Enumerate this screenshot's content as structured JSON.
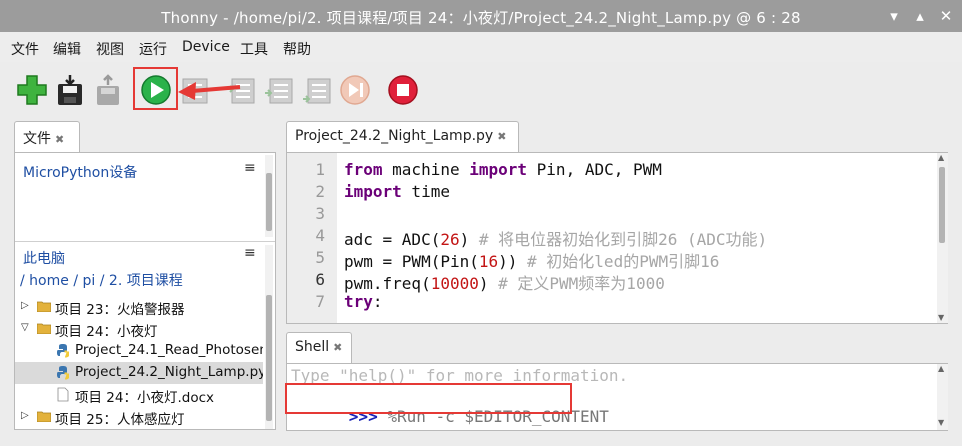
{
  "window": {
    "title": "Thonny  -  /home/pi/2. 项目课程/项目 24：小夜灯/Project_24.2_Night_Lamp.py  @  6 : 28",
    "controls": [
      "▾",
      "▴",
      "✕"
    ]
  },
  "menubar": {
    "items": [
      "文件",
      "编辑",
      "视图",
      "运行",
      "Device",
      "工具",
      "帮助"
    ]
  },
  "toolbar": {
    "buttons": [
      "new",
      "save",
      "load",
      "run",
      "debug",
      "step-over",
      "step-into",
      "step-out",
      "resume",
      "stop"
    ]
  },
  "files_panel": {
    "tab_label": "文件",
    "device_section": "MicroPython设备",
    "computer_section": "此电脑",
    "breadcrumb": {
      "root": "/",
      "home": "home",
      "sep1": "/",
      "pi": "pi",
      "sep2": "/",
      "folder": "2. 项目课程"
    },
    "tree": [
      {
        "arrow": "▷",
        "type": "folder",
        "label": "项目 23：火焰警报器"
      },
      {
        "arrow": "▽",
        "type": "folder",
        "label": "项目 24：小夜灯"
      },
      {
        "arrow": "",
        "type": "python",
        "label": "Project_24.1_Read_Photosensitive.py"
      },
      {
        "arrow": "",
        "type": "python",
        "label": "Project_24.2_Night_Lamp.py",
        "selected": true
      },
      {
        "arrow": "",
        "type": "doc",
        "label": "项目 24：小夜灯.docx"
      },
      {
        "arrow": "▷",
        "type": "folder",
        "label": "项目 25：人体感应灯"
      }
    ]
  },
  "editor": {
    "tab_label": "Project_24.2_Night_Lamp.py",
    "current_line": 6,
    "lines": [
      {
        "n": "1",
        "parts": [
          [
            "kw",
            "from"
          ],
          [
            "",
            " machine "
          ],
          [
            "kw",
            "import"
          ],
          [
            "",
            " Pin, ADC, PWM"
          ]
        ]
      },
      {
        "n": "2",
        "parts": [
          [
            "kw",
            "import"
          ],
          [
            "",
            " time"
          ]
        ]
      },
      {
        "n": "3",
        "parts": []
      },
      {
        "n": "4",
        "parts": [
          [
            "",
            "adc = ADC("
          ],
          [
            "num",
            "26"
          ],
          [
            "",
            ") "
          ],
          [
            "cm",
            "# 将电位器初始化到引脚26 (ADC功能)"
          ]
        ]
      },
      {
        "n": "5",
        "parts": [
          [
            "",
            "pwm = PWM(Pin("
          ],
          [
            "num",
            "16"
          ],
          [
            "",
            ")) "
          ],
          [
            "cm",
            "# 初始化led的PWM引脚16"
          ]
        ]
      },
      {
        "n": "6",
        "parts": [
          [
            "",
            "pwm.freq("
          ],
          [
            "num",
            "10000"
          ],
          [
            "",
            ") "
          ],
          [
            "cm",
            "# 定义PWM频率为1000"
          ]
        ]
      },
      {
        "n": "7",
        "parts": [
          [
            "kw",
            "try"
          ],
          [
            "",
            ":"
          ]
        ]
      }
    ]
  },
  "shell": {
    "tab_label": "Shell",
    "hint": "Type \"help()\" for more information.",
    "prompt": ">>>",
    "command": " %Run -c $EDITOR_CONTENT"
  },
  "colors": {
    "keyword": "#6b0078",
    "number": "#c31515",
    "comment": "#a6a6a6",
    "highlight": "#e53935",
    "section_title": "#1f4fa3"
  }
}
